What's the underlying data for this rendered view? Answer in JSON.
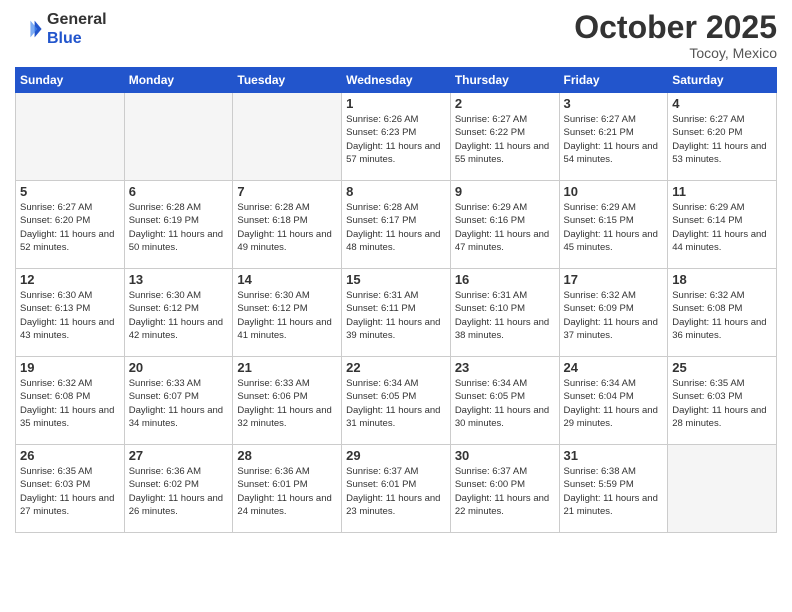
{
  "header": {
    "logo_general": "General",
    "logo_blue": "Blue",
    "month_title": "October 2025",
    "location": "Tocoy, Mexico"
  },
  "days_of_week": [
    "Sunday",
    "Monday",
    "Tuesday",
    "Wednesday",
    "Thursday",
    "Friday",
    "Saturday"
  ],
  "weeks": [
    [
      {
        "day": "",
        "empty": true
      },
      {
        "day": "",
        "empty": true
      },
      {
        "day": "",
        "empty": true
      },
      {
        "day": "1",
        "sunrise": "6:26 AM",
        "sunset": "6:23 PM",
        "daylight": "11 hours and 57 minutes."
      },
      {
        "day": "2",
        "sunrise": "6:27 AM",
        "sunset": "6:22 PM",
        "daylight": "11 hours and 55 minutes."
      },
      {
        "day": "3",
        "sunrise": "6:27 AM",
        "sunset": "6:21 PM",
        "daylight": "11 hours and 54 minutes."
      },
      {
        "day": "4",
        "sunrise": "6:27 AM",
        "sunset": "6:20 PM",
        "daylight": "11 hours and 53 minutes."
      }
    ],
    [
      {
        "day": "5",
        "sunrise": "6:27 AM",
        "sunset": "6:20 PM",
        "daylight": "11 hours and 52 minutes."
      },
      {
        "day": "6",
        "sunrise": "6:28 AM",
        "sunset": "6:19 PM",
        "daylight": "11 hours and 50 minutes."
      },
      {
        "day": "7",
        "sunrise": "6:28 AM",
        "sunset": "6:18 PM",
        "daylight": "11 hours and 49 minutes."
      },
      {
        "day": "8",
        "sunrise": "6:28 AM",
        "sunset": "6:17 PM",
        "daylight": "11 hours and 48 minutes."
      },
      {
        "day": "9",
        "sunrise": "6:29 AM",
        "sunset": "6:16 PM",
        "daylight": "11 hours and 47 minutes."
      },
      {
        "day": "10",
        "sunrise": "6:29 AM",
        "sunset": "6:15 PM",
        "daylight": "11 hours and 45 minutes."
      },
      {
        "day": "11",
        "sunrise": "6:29 AM",
        "sunset": "6:14 PM",
        "daylight": "11 hours and 44 minutes."
      }
    ],
    [
      {
        "day": "12",
        "sunrise": "6:30 AM",
        "sunset": "6:13 PM",
        "daylight": "11 hours and 43 minutes."
      },
      {
        "day": "13",
        "sunrise": "6:30 AM",
        "sunset": "6:12 PM",
        "daylight": "11 hours and 42 minutes."
      },
      {
        "day": "14",
        "sunrise": "6:30 AM",
        "sunset": "6:12 PM",
        "daylight": "11 hours and 41 minutes."
      },
      {
        "day": "15",
        "sunrise": "6:31 AM",
        "sunset": "6:11 PM",
        "daylight": "11 hours and 39 minutes."
      },
      {
        "day": "16",
        "sunrise": "6:31 AM",
        "sunset": "6:10 PM",
        "daylight": "11 hours and 38 minutes."
      },
      {
        "day": "17",
        "sunrise": "6:32 AM",
        "sunset": "6:09 PM",
        "daylight": "11 hours and 37 minutes."
      },
      {
        "day": "18",
        "sunrise": "6:32 AM",
        "sunset": "6:08 PM",
        "daylight": "11 hours and 36 minutes."
      }
    ],
    [
      {
        "day": "19",
        "sunrise": "6:32 AM",
        "sunset": "6:08 PM",
        "daylight": "11 hours and 35 minutes."
      },
      {
        "day": "20",
        "sunrise": "6:33 AM",
        "sunset": "6:07 PM",
        "daylight": "11 hours and 34 minutes."
      },
      {
        "day": "21",
        "sunrise": "6:33 AM",
        "sunset": "6:06 PM",
        "daylight": "11 hours and 32 minutes."
      },
      {
        "day": "22",
        "sunrise": "6:34 AM",
        "sunset": "6:05 PM",
        "daylight": "11 hours and 31 minutes."
      },
      {
        "day": "23",
        "sunrise": "6:34 AM",
        "sunset": "6:05 PM",
        "daylight": "11 hours and 30 minutes."
      },
      {
        "day": "24",
        "sunrise": "6:34 AM",
        "sunset": "6:04 PM",
        "daylight": "11 hours and 29 minutes."
      },
      {
        "day": "25",
        "sunrise": "6:35 AM",
        "sunset": "6:03 PM",
        "daylight": "11 hours and 28 minutes."
      }
    ],
    [
      {
        "day": "26",
        "sunrise": "6:35 AM",
        "sunset": "6:03 PM",
        "daylight": "11 hours and 27 minutes."
      },
      {
        "day": "27",
        "sunrise": "6:36 AM",
        "sunset": "6:02 PM",
        "daylight": "11 hours and 26 minutes."
      },
      {
        "day": "28",
        "sunrise": "6:36 AM",
        "sunset": "6:01 PM",
        "daylight": "11 hours and 24 minutes."
      },
      {
        "day": "29",
        "sunrise": "6:37 AM",
        "sunset": "6:01 PM",
        "daylight": "11 hours and 23 minutes."
      },
      {
        "day": "30",
        "sunrise": "6:37 AM",
        "sunset": "6:00 PM",
        "daylight": "11 hours and 22 minutes."
      },
      {
        "day": "31",
        "sunrise": "6:38 AM",
        "sunset": "5:59 PM",
        "daylight": "11 hours and 21 minutes."
      },
      {
        "day": "",
        "empty": true
      }
    ]
  ],
  "labels": {
    "sunrise": "Sunrise:",
    "sunset": "Sunset:",
    "daylight": "Daylight:"
  }
}
